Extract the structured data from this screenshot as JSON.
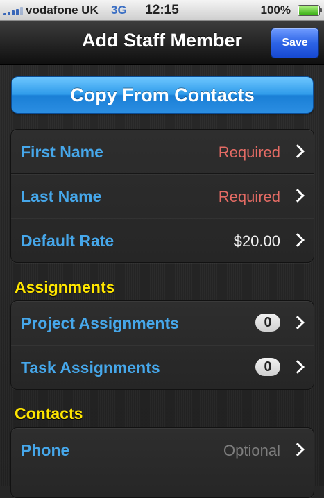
{
  "status": {
    "carrier": "vodafone UK",
    "network": "3G",
    "time": "12:15",
    "battery_pct": "100%",
    "battery_level": 1.0
  },
  "nav": {
    "title": "Add Staff Member",
    "save_label": "Save"
  },
  "copy_button": "Copy From Contacts",
  "details": [
    {
      "label": "First Name",
      "value": "Required"
    },
    {
      "label": "Last Name",
      "value": "Required"
    },
    {
      "label": "Default Rate",
      "value": "$20.00"
    }
  ],
  "assignments": {
    "header": "Assignments",
    "rows": [
      {
        "label": "Project Assignments",
        "count": "0"
      },
      {
        "label": "Task Assignments",
        "count": "0"
      }
    ]
  },
  "contacts": {
    "header": "Contacts",
    "rows": [
      {
        "label": "Phone",
        "value": "Optional"
      }
    ]
  },
  "colors": {
    "label_blue": "#46a7ea",
    "required_red": "#e46b64",
    "header_yellow": "#ffe600",
    "save_blue": "#2d64e6"
  }
}
